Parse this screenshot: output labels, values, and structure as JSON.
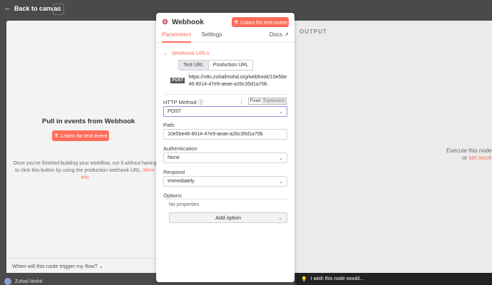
{
  "canvas": {
    "back_label": "Back to canvas",
    "plus_label": "+",
    "user_name": "Zuhail Mohd",
    "wish_label": "I wish this node would..."
  },
  "input_panel": {
    "title": "Pull in events from Webhook",
    "listen_label": "Listen for test event",
    "help_text": "Once you've finished building your workflow, run it without having to click this button by using the production webhook URL.",
    "more_info": "More info",
    "trigger_question": "When will this node trigger my flow?"
  },
  "output_panel": {
    "label": "OUTPUT",
    "execute_text": "Execute this node t",
    "or_text": "or",
    "set_mock": "set mock"
  },
  "node": {
    "title": "Webhook",
    "listen_label": "Listen for test event",
    "tabs": [
      {
        "label": "Parameters",
        "active": true
      },
      {
        "label": "Settings",
        "active": false
      },
      {
        "label": "Docs",
        "active": false
      }
    ],
    "webhook_urls_label": "Webhook URLs",
    "url_toggle": {
      "test": "Test URL",
      "production": "Production URL",
      "selected": "Test URL"
    },
    "method_tag": "POST",
    "webhook_url": "https://n8n.zuhailmohd.org/webhook/10e5be46-8014-47e9-aeae-a26c35d1a70b",
    "http_method": {
      "label": "HTTP Method",
      "fixed": "Fixed",
      "expression": "Expression",
      "value": "POST"
    },
    "path": {
      "label": "Path",
      "value": "10e5be46-8014-47e9-aeae-a26c35d1a70b"
    },
    "authentication": {
      "label": "Authentication",
      "value": "None"
    },
    "respond": {
      "label": "Respond",
      "value": "Immediately"
    },
    "options": {
      "label": "Options",
      "empty": "No properties",
      "add_label": "Add option"
    }
  },
  "colors": {
    "accent": "#ff6d5a",
    "focus_border": "#9a8fe0",
    "backdrop": "#4a4a4a"
  }
}
